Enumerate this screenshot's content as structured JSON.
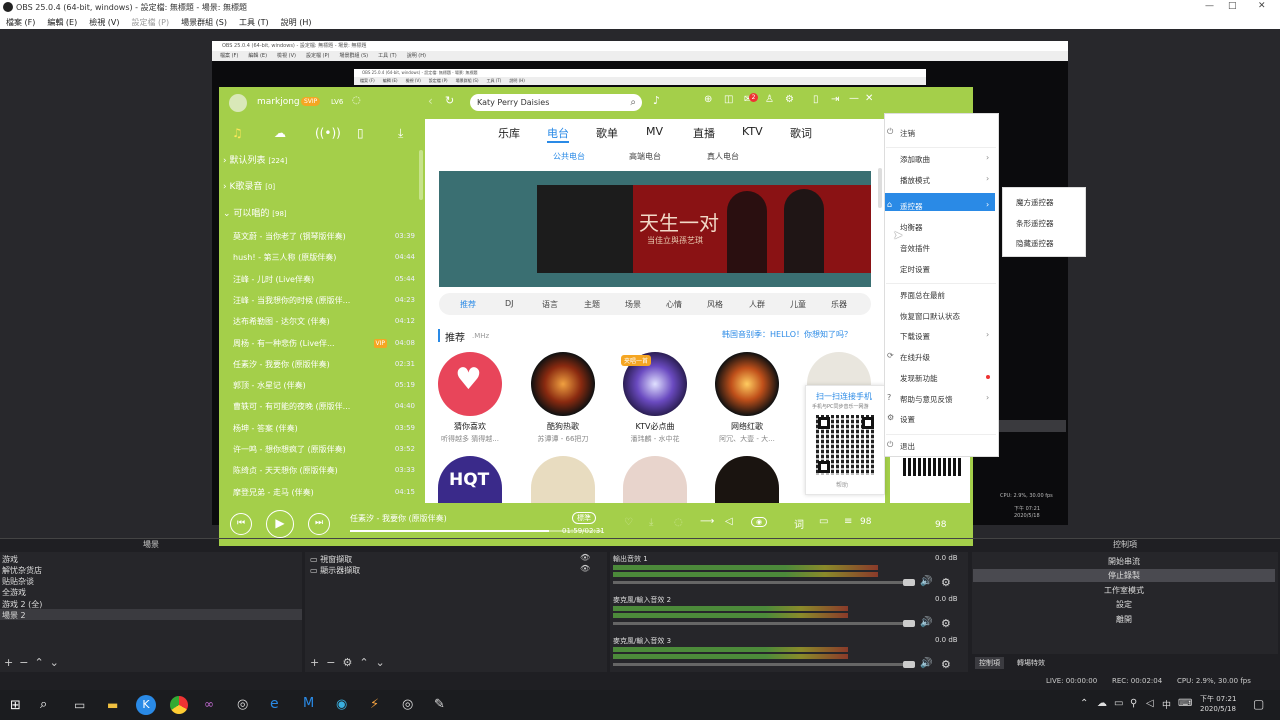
{
  "obs": {
    "title": "OBS 25.0.4 (64-bit, windows) - 設定檔: 無標題 - 場景: 無標題",
    "menu": [
      "檔案 (F)",
      "編輯 (E)",
      "檢視 (V)",
      "設定檔 (P)",
      "場景群組 (S)",
      "工具 (T)",
      "說明 (H)"
    ],
    "nested_title": "OBS 25.0.4 (64-bit, windows) - 設定檔: 無標題 - 場景: 無標題",
    "docks": {
      "scenes_header": "場景",
      "scenes": [
        "游戏",
        "解忧杂货店",
        "贴贴杂谈",
        "全游戏",
        "游戏 2 (全)",
        "場景 2"
      ],
      "sources": [
        {
          "label": "視窗擷取"
        },
        {
          "label": "顯示器擷取"
        }
      ],
      "mixer": [
        {
          "name": "輸出音效 1",
          "db": "0.0 dB",
          "level": 0.78
        },
        {
          "name": "麥克風/輸入音效 2",
          "db": "0.0 dB",
          "level": 0.69
        },
        {
          "name": "麥克風/輸入音效 3",
          "db": "0.0 dB",
          "level": 0.69
        }
      ],
      "controls_header": "控制項",
      "controls": [
        "開始串流",
        "停止錄製",
        "工作室模式",
        "設定",
        "離開"
      ],
      "tabs": [
        "控制項",
        "轉場特效"
      ]
    },
    "status": {
      "live": "LIVE: 00:00:00",
      "rec": "REC: 00:02:04",
      "cpu": "CPU: 2.9%, 30.00 fps"
    }
  },
  "kugou": {
    "user": "markjong",
    "svip": "SVIP",
    "level": "LV6",
    "search_value": "Katy Perry Daisies",
    "badge": "2",
    "tabs": [
      "乐库",
      "电台",
      "歌单",
      "MV",
      "直播",
      "KTV",
      "歌词"
    ],
    "active_tab": "电台",
    "sub_tabs": [
      "公共电台",
      "高端电台",
      "真人电台"
    ],
    "banner_text": "天生一对",
    "banner_sub": "当佳立與孫艺琪",
    "categories": [
      "推荐",
      "DJ",
      "语言",
      "主题",
      "场景",
      "心情",
      "风格",
      "人群",
      "儿童",
      "乐器"
    ],
    "section_title": "推荐",
    "section_sub": ".MHz",
    "section_link": "韩国音别季：HELLO！你想知了吗？",
    "stations": [
      {
        "name": "猜你喜欢",
        "desc": "听得越多 猜得越..."
      },
      {
        "name": "酷狗热歌",
        "desc": "苏谭谭 - 66把刀"
      },
      {
        "name": "KTV必点曲",
        "desc": "潘玮麟 - 水中花",
        "tag": "夹唱一首"
      },
      {
        "name": "网络红歌",
        "desc": "阿冗、大壹 - 大..."
      }
    ],
    "qr_title": "扫一扫连接手机",
    "qr_sub": "手机与PC同步音乐一网游",
    "qr_help": "帮助",
    "lists": [
      {
        "label": "默认列表",
        "count": "[224]"
      },
      {
        "label": "K歌录音",
        "count": "[0]"
      },
      {
        "label": "可以唱的",
        "count": "[98]"
      }
    ],
    "songs": [
      {
        "title": "莫文蔚 - 当你老了 (钢琴版伴奏)",
        "dur": "03:39"
      },
      {
        "title": "hush! - 第三人称 (原版伴奏)",
        "dur": "04:44"
      },
      {
        "title": "汪峰 - 儿时 (Live伴奏)",
        "dur": "05:44"
      },
      {
        "title": "汪峰 - 当我想你的时候 (原版伴...",
        "dur": "04:23"
      },
      {
        "title": "达布希勒图 - 达尔文 (伴奏)",
        "dur": "04:12"
      },
      {
        "title": "周杨 - 有一种悲伤 (Live伴...",
        "dur": "04:08",
        "tag": "VIP"
      },
      {
        "title": "任素汐 - 我要你 (原版伴奏)",
        "dur": "02:31"
      },
      {
        "title": "郭顶 - 水星记 (伴奏)",
        "dur": "05:19"
      },
      {
        "title": "曹轶可 - 有可能的夜晚 (原版伴...",
        "dur": "04:40"
      },
      {
        "title": "杨坤 - 答案 (伴奏)",
        "dur": "03:59"
      },
      {
        "title": "许一鸣 - 想你想疯了 (原版伴奏)",
        "dur": "03:52"
      },
      {
        "title": "陈绮贞 - 天天想你 (原版伴奏)",
        "dur": "03:33"
      },
      {
        "title": "摩登兄弟 - 走马 (伴奏)",
        "dur": "04:15"
      }
    ],
    "now_playing": "任素汐 - 我要你 (原版伴奏)",
    "quality": "標準",
    "progress_text": "01:59/02:31",
    "progress": 0.79,
    "queue_count": "98"
  },
  "menu": {
    "items": [
      "注销",
      "添加歌曲",
      "播放模式",
      "遥控器",
      "均衡器",
      "音效插件",
      "定时设置",
      "界面总在最前",
      "恢复窗口默认状态",
      "下载设置",
      "在线升级",
      "发现新功能",
      "帮助与意见反馈",
      "设置",
      "退出"
    ],
    "highlighted": "遥控器",
    "submenu": [
      "魔方遥控器",
      "条形遥控器",
      "隐藏遥控器"
    ]
  },
  "taskbar": {
    "time": "下午 07:21",
    "date": "2020/5/18",
    "ime": "中"
  },
  "colors": {
    "kugou_green": "#a4cf4a",
    "kugou_blue": "#2a8ae6",
    "obs_bg": "#1f1f23"
  }
}
